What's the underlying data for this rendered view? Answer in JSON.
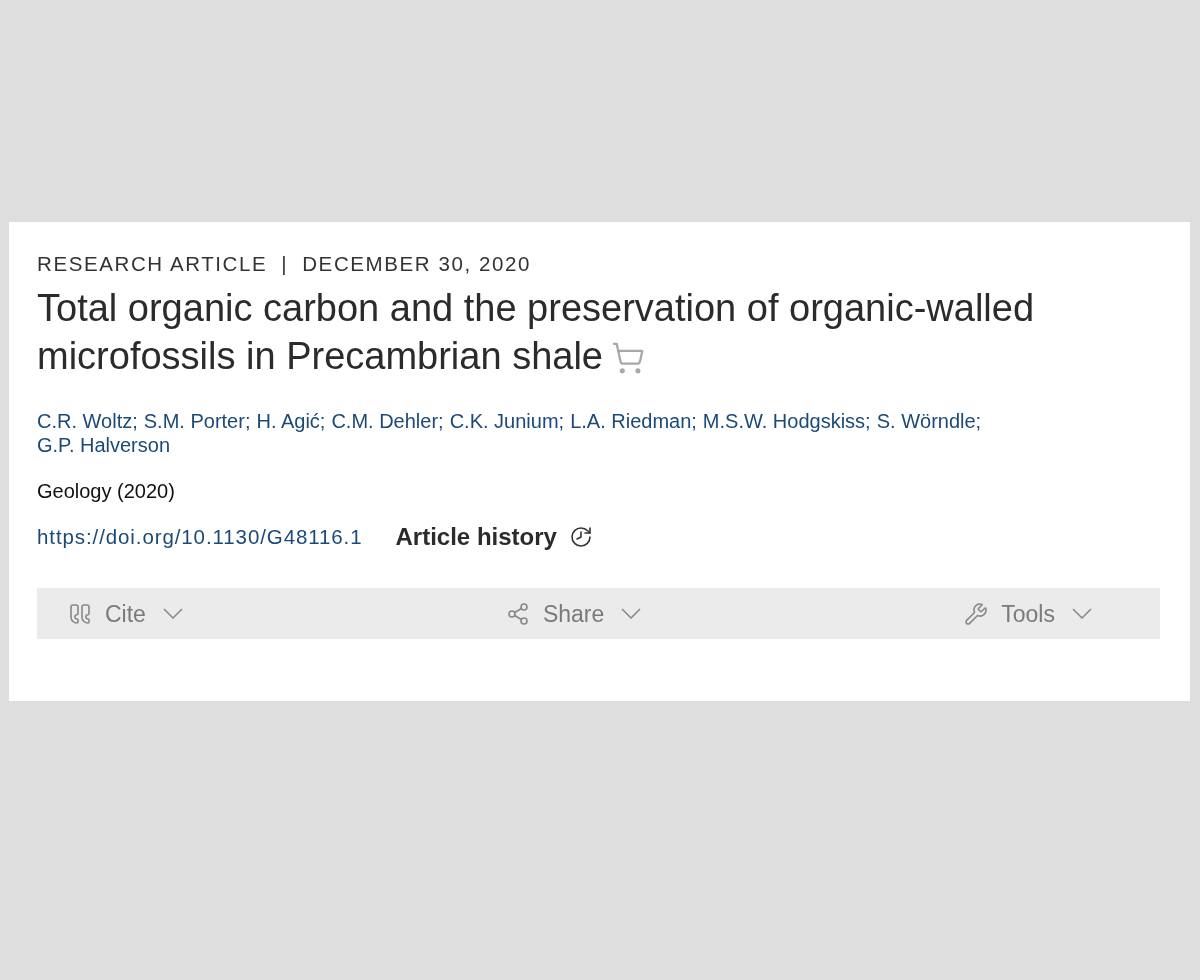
{
  "article": {
    "type": "RESEARCH ARTICLE",
    "separator": "|",
    "date": "DECEMBER 30, 2020",
    "title_lines": [
      "Total organic carbon and the preservation of organic-walled",
      "microfossils in Precambrian shale"
    ],
    "purchase": true
  },
  "authors": [
    "C.R. Woltz;",
    "S.M. Porter;",
    "H. Agić;",
    "C.M. Dehler;",
    "C.K. Junium;",
    "L.A. Riedman;",
    "M.S.W. Hodgskiss;",
    "S. Wörndle;",
    "G.P. Halverson"
  ],
  "journal": "Geology (2020)",
  "doi": "https://doi.org/10.1130/G48116.1",
  "history_button": "Article history",
  "actions": [
    {
      "kind": "cite",
      "label": "Cite"
    },
    {
      "kind": "share",
      "label": "Share"
    },
    {
      "kind": "tools",
      "label": "Tools"
    }
  ]
}
